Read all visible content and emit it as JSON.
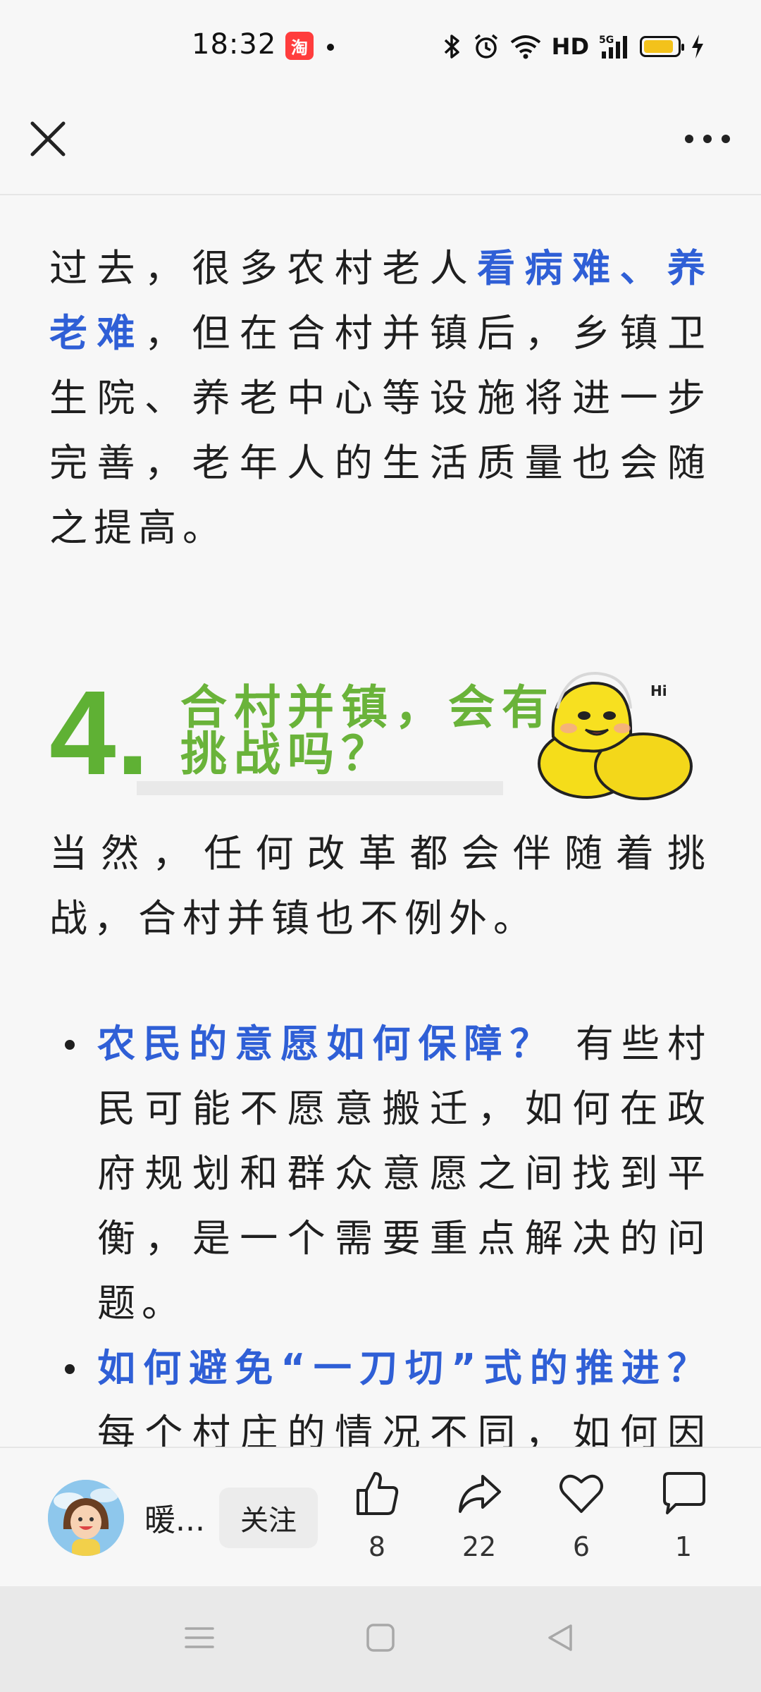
{
  "status_bar": {
    "time": "18:32",
    "app_badge": "淘",
    "network_label": "HD",
    "signal_label": "5G",
    "battery_color": "#f3c21b"
  },
  "nav": {
    "close_icon": "close-icon",
    "more_icon": "more-horizontal-icon"
  },
  "article": {
    "p1_prefix": "过去，很多农村老人",
    "p1_highlight": "看病难、养老难",
    "p1_suffix": "，但在合村并镇后，乡镇卫生院、养老中心等设施将进一步完善，老年人的生活质量也会随之提高。",
    "section": {
      "number": "4.",
      "title": "合村并镇，会有挑战吗？",
      "sticker_text": "Hi"
    },
    "p2": "当然，任何改革都会伴随着挑战，合村并镇也不例外。",
    "bullets": [
      {
        "highlight": "农民的意愿如何保障？",
        "text": "有些村民可能不愿意搬迁，如何在政府规划和群众意愿之间找到平衡，是一个需要重点解决的问题。"
      },
      {
        "highlight": "如何避免“一刀切”式的推进？",
        "text": "每个村庄的情况不同，如何因地制宜，而不是简单地“合并了事”，是"
      }
    ],
    "highlight_color": "#2f5fd6",
    "section_color": "#5fb134"
  },
  "action_bar": {
    "author_name": "暖...",
    "follow_label": "关注",
    "like_count": "8",
    "share_count": "22",
    "favorite_count": "6",
    "comment_count": "1"
  }
}
